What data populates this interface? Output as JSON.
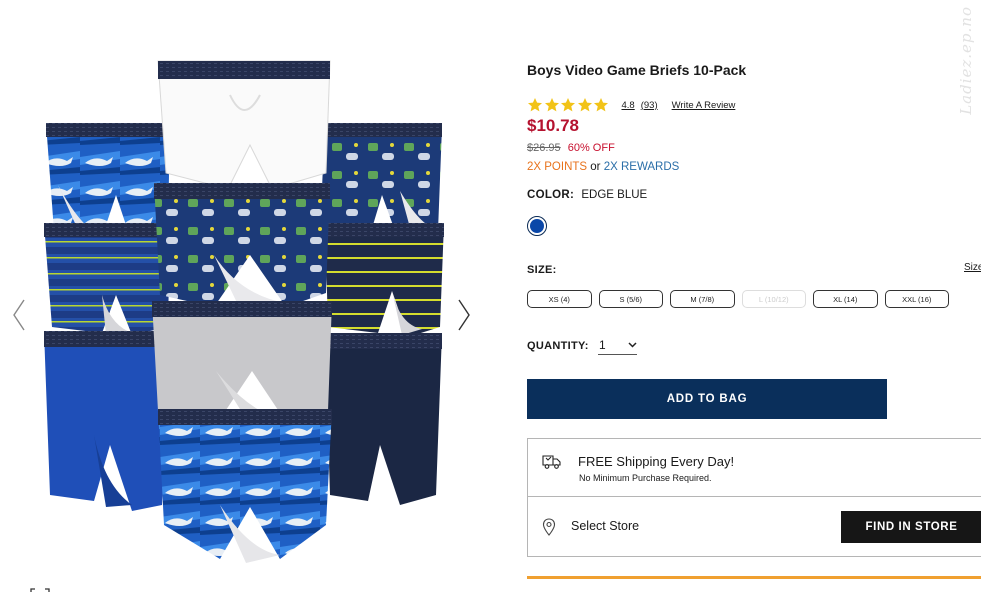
{
  "product": {
    "title": "Boys Video Game Briefs 10-Pack",
    "rating": "4.8",
    "rating_value": 4.8,
    "review_count": "(93)",
    "write_review": "Write A Review",
    "price": "$10.78",
    "original_price": "$26.95",
    "discount": "60% OFF",
    "points": "2X POINTS",
    "or_text": "or",
    "rewards": "2X REWARDS"
  },
  "color": {
    "label": "COLOR:",
    "value": "EDGE BLUE",
    "swatch_hex": "#0a47a8"
  },
  "size": {
    "label": "SIZE:",
    "guide_link": "Size",
    "options": [
      "XS (4)",
      "S (5/6)",
      "M (7/8)",
      "L (10/12)",
      "XL (14)",
      "XXL (16)"
    ],
    "disabled": [
      "L (10/12)"
    ]
  },
  "quantity": {
    "label": "QUANTITY:",
    "value": "1"
  },
  "actions": {
    "add_to_bag": "ADD TO BAG",
    "find_in_store": "FIND IN STORE"
  },
  "shipping": {
    "title": "FREE Shipping Every Day!",
    "subtitle": "No Minimum Purchase Required.",
    "store_label": "Select Store"
  },
  "watermark": "Ladiez.ep.no",
  "colors": {
    "price_red": "#b5122f",
    "points_orange": "#e8731c",
    "rewards_blue": "#2a6ea8",
    "add_bag_navy": "#0a2f5b",
    "accent_line": "#f0a030"
  },
  "icons": [
    "chevron-left-icon",
    "chevron-right-icon",
    "star-icon",
    "truck-icon",
    "location-pin-icon",
    "chevron-down-icon",
    "expand-icon"
  ]
}
